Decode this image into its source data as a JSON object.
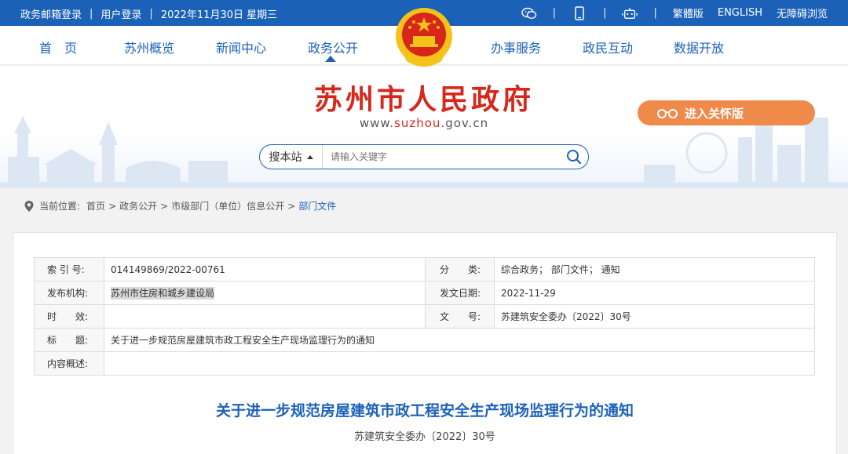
{
  "topbar": {
    "left_links": [
      "政务邮箱登录",
      "用户登录",
      "2022年11月30日 星期三"
    ],
    "separator": "|",
    "right_icons": [
      "wechat-icon",
      "mobile-icon",
      "robot-icon"
    ],
    "right_links": [
      "繁體版",
      "ENGLISH",
      "无障碍浏览"
    ]
  },
  "nav": {
    "items": [
      "首　页",
      "苏州概览",
      "新闻中心",
      "政务公开",
      "办事服务",
      "政民互动",
      "数据开放"
    ],
    "active": "政务公开"
  },
  "banner": {
    "title": "苏州市人民政府",
    "url_prefix": "www.",
    "url_highlight": "suzhou",
    "url_suffix": ".gov.cn",
    "care_label": "进入关怀版"
  },
  "search": {
    "scope_label": "搜本站",
    "placeholder": "请输入关键字"
  },
  "breadcrumb": {
    "prefix": "当前位置:",
    "items": [
      "首页",
      "政务公开",
      "市级部门（单位）信息公开"
    ],
    "current": "部门文件",
    "separator": ">"
  },
  "meta": {
    "index_label": "索 引 号:",
    "index_value": "014149869/2022-00761",
    "category_label": "分　　类:",
    "category_value": "综合政务； 部门文件； 通知",
    "issuer_label": "发布机构:",
    "issuer_value": "苏州市住房和城乡建设局",
    "date_label": "发文日期:",
    "date_value": "2022-11-29",
    "validity_label": "时　　效:",
    "validity_value": "",
    "docno_label": "文　　号:",
    "docno_value": "苏建筑安全委办〔2022〕30号",
    "title_label": "标　　题:",
    "title_value": "关于进一步规范房屋建筑市政工程安全生产现场监理行为的通知",
    "summary_label": "内容概述:",
    "summary_value": ""
  },
  "document": {
    "title": "关于进一步规范房屋建筑市政工程安全生产现场监理行为的通知",
    "number": "苏建筑安全委办〔2022〕30号"
  },
  "colors": {
    "primary": "#1c61b8",
    "title_red": "#d8261b",
    "care_orange": "#f08a4b"
  }
}
